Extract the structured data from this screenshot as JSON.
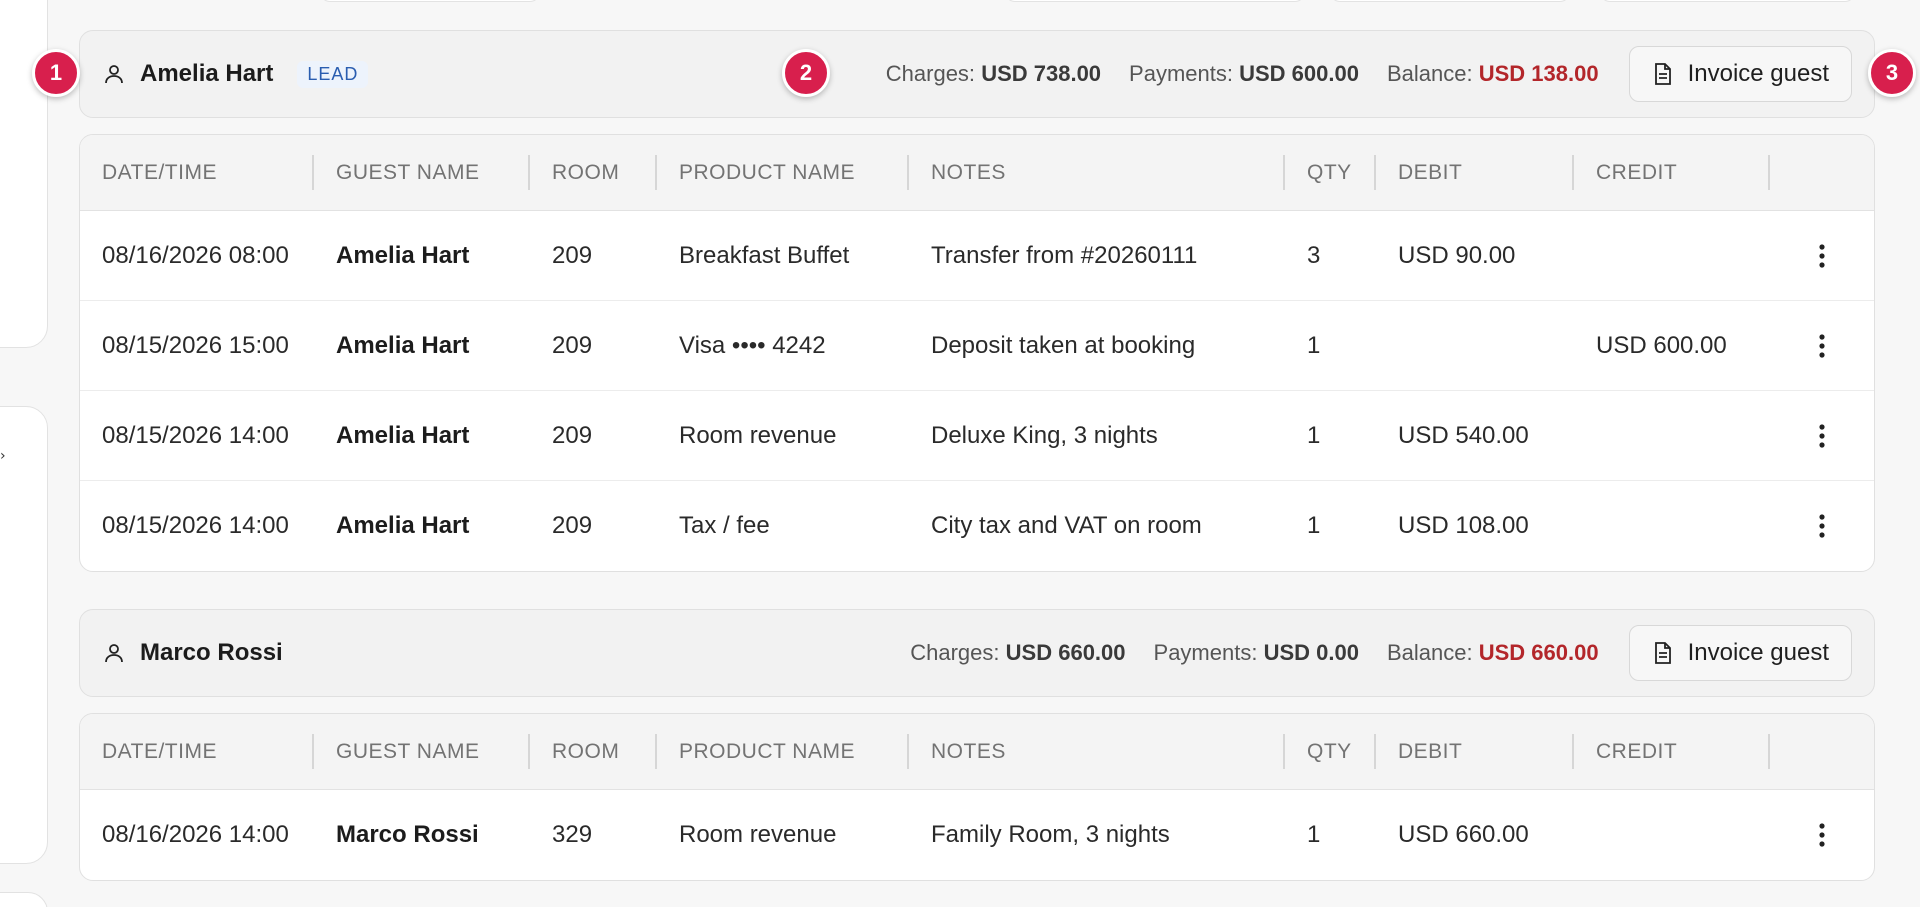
{
  "markers": [
    "1",
    "2",
    "3"
  ],
  "columns": [
    "DATE/TIME",
    "GUEST NAME",
    "ROOM",
    "PRODUCT NAME",
    "NOTES",
    "QTY",
    "DEBIT",
    "CREDIT"
  ],
  "guests": [
    {
      "name": "Amelia Hart",
      "badge": "LEAD",
      "charges_label": "Charges:",
      "charges": "USD 738.00",
      "payments_label": "Payments:",
      "payments": "USD 600.00",
      "balance_label": "Balance:",
      "balance": "USD 138.00",
      "invoice_label": "Invoice guest",
      "rows": [
        {
          "datetime": "08/16/2026 08:00",
          "guest": "Amelia Hart",
          "room": "209",
          "product": "Breakfast Buffet",
          "notes": "Transfer from #20260111",
          "qty": "3",
          "debit": "USD 90.00",
          "credit": ""
        },
        {
          "datetime": "08/15/2026 15:00",
          "guest": "Amelia Hart",
          "room": "209",
          "product": "Visa •••• 4242",
          "notes": "Deposit taken at booking",
          "qty": "1",
          "debit": "",
          "credit": "USD 600.00"
        },
        {
          "datetime": "08/15/2026 14:00",
          "guest": "Amelia Hart",
          "room": "209",
          "product": "Room revenue",
          "notes": "Deluxe King, 3 nights",
          "qty": "1",
          "debit": "USD 540.00",
          "credit": ""
        },
        {
          "datetime": "08/15/2026 14:00",
          "guest": "Amelia Hart",
          "room": "209",
          "product": "Tax / fee",
          "notes": "City tax and VAT on room",
          "qty": "1",
          "debit": "USD 108.00",
          "credit": ""
        }
      ]
    },
    {
      "name": "Marco Rossi",
      "badge": "",
      "charges_label": "Charges:",
      "charges": "USD 660.00",
      "payments_label": "Payments:",
      "payments": "USD 0.00",
      "balance_label": "Balance:",
      "balance": "USD 660.00",
      "invoice_label": "Invoice guest",
      "rows": [
        {
          "datetime": "08/16/2026 14:00",
          "guest": "Marco Rossi",
          "room": "329",
          "product": "Room revenue",
          "notes": "Family Room, 3 nights",
          "qty": "1",
          "debit": "USD 660.00",
          "credit": ""
        }
      ]
    }
  ],
  "colors": {
    "accent_balance": "#b3262a",
    "marker": "#d81f4d",
    "badge": "#2a5db0"
  }
}
